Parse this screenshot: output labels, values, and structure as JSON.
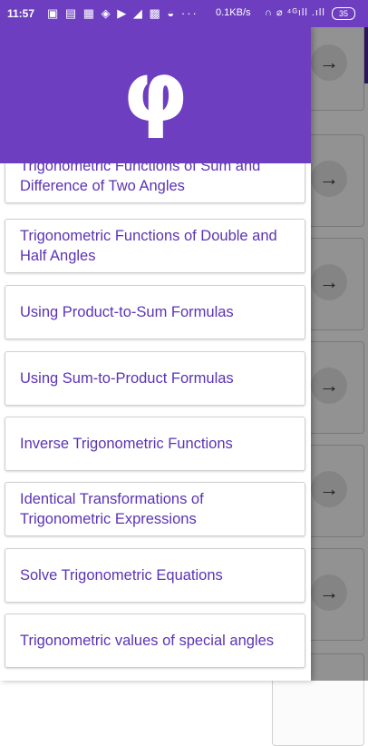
{
  "status_bar": {
    "time": "11:57",
    "notification_icons": "▣ ▤ ▦ ◈ ▶ ◢ ▩ ◒ ···",
    "net_speed": "0.1KB/s",
    "signal": "∩ ⌀ ⁴ᴳıll .ıll",
    "battery": "35"
  },
  "drawer": {
    "logo_glyph": "φ",
    "items": [
      {
        "label": "Trigonometric Functions of Sum and Difference of Two Angles"
      },
      {
        "label": "Trigonometric Functions of Double and Half Angles"
      },
      {
        "label": "Using Product-to-Sum Formulas"
      },
      {
        "label": "Using Sum-to-Product Formulas"
      },
      {
        "label": "Inverse Trigonometric Functions"
      },
      {
        "label": "Identical Transformations of Trigonometric Expressions"
      },
      {
        "label": "Solve Trigonometric Equations"
      },
      {
        "label": "Trigonometric values of special angles"
      }
    ]
  },
  "background": {
    "arrow_glyph": "→"
  },
  "colors": {
    "primary": "#6d3fc0",
    "primary_dark": "#4a2996",
    "item_text": "#5b33b5"
  }
}
